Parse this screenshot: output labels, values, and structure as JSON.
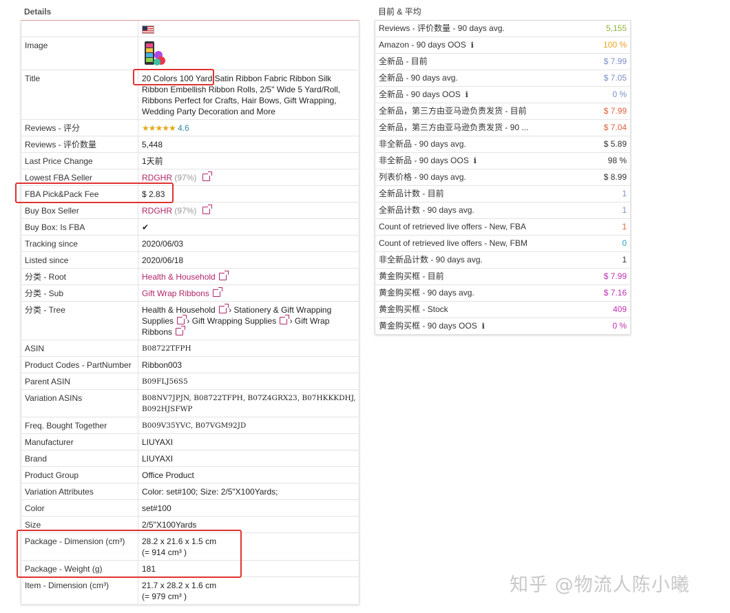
{
  "details": {
    "title": "Details",
    "image_label": "Image",
    "title_label": "Title",
    "title_value": "20 Colors 100 Yard Satin Ribbon Fabric Ribbon Silk Ribbon Embellish Ribbon Rolls, 2/5\" Wide 5 Yard/Roll, Ribbons Perfect for Crafts, Hair Bows, Gift Wrapping, Wedding Party Decoration and More",
    "reviews_rating_label": "Reviews - 评分",
    "reviews_rating_value": "4.6",
    "reviews_count_label": "Reviews - 评价数量",
    "reviews_count_value": "5,448",
    "last_price_change_label": "Last Price Change",
    "last_price_change_value": "1天前",
    "lowest_fba_seller_label": "Lowest FBA Seller",
    "lowest_fba_seller_value": "RDGHR",
    "lowest_fba_seller_pct": "(97%)",
    "fba_fee_label": "FBA Pick&Pack Fee",
    "fba_fee_value": "$ 2.83",
    "buybox_seller_label": "Buy Box Seller",
    "buybox_seller_value": "RDGHR",
    "buybox_seller_pct": "(97%)",
    "buybox_fba_label": "Buy Box: Is FBA",
    "buybox_fba_value": "✔",
    "tracking_since_label": "Tracking since",
    "tracking_since_value": "2020/06/03",
    "listed_since_label": "Listed since",
    "listed_since_value": "2020/06/18",
    "cat_root_label": "分类 - Root",
    "cat_root_value": "Health & Household",
    "cat_sub_label": "分类 - Sub",
    "cat_sub_value": "Gift Wrap Ribbons",
    "cat_tree_label": "分类 - Tree",
    "cat_tree_1": "Health & Household",
    "cat_tree_2": "Stationery & Gift Wrapping Supplies",
    "cat_tree_3": "Gift Wrapping Supplies",
    "cat_tree_4": "Gift Wrap Ribbons",
    "tree_sep": "›",
    "asin_label": "ASIN",
    "asin_value": "B08722TFPH",
    "partnumber_label": "Product Codes - PartNumber",
    "partnumber_value": "Ribbon003",
    "parent_asin_label": "Parent ASIN",
    "parent_asin_value": "B09FLJ56S5",
    "variation_asins_label": "Variation ASINs",
    "variation_asins_value": "B08NV7JPJN, B08722TFPH, B07Z4GRX23, B07HKKKDHJ, B092HJSFWP",
    "freq_bought_label": "Freq. Bought Together",
    "freq_bought_value": "B009V35YVC, B07VGM92JD",
    "manufacturer_label": "Manufacturer",
    "manufacturer_value": "LIUYAXI",
    "brand_label": "Brand",
    "brand_value": "LIUYAXI",
    "product_group_label": "Product Group",
    "product_group_value": "Office Product",
    "variation_attr_label": "Variation Attributes",
    "variation_attr_value": "Color: set#100; Size: 2/5\"X100Yards;",
    "color_label": "Color",
    "color_value": "set#100",
    "size_label": "Size",
    "size_value": "2/5\"X100Yards",
    "pkg_dim_label": "Package - Dimension (cm³)",
    "pkg_dim_value": "28.2 x 21.6 x 1.5 cm",
    "pkg_dim_volume": "(= 914 cm³ )",
    "pkg_weight_label": "Package - Weight (g)",
    "pkg_weight_value": "181",
    "item_dim_label": "Item - Dimension (cm³)",
    "item_dim_value": "21.7 x 28.2 x 1.6 cm",
    "item_dim_volume": "(= 979 cm³ )"
  },
  "current": {
    "title": "目前 & 平均",
    "rows": [
      {
        "label": "Reviews - 评价数量 - 90 days avg.",
        "value": "5,155",
        "color": "#8db23a",
        "info": false
      },
      {
        "label": "Amazon - 90 days OOS",
        "value": "100 %",
        "color": "#f0a020",
        "info": true
      },
      {
        "label": "全新品 - 目前",
        "value": "$ 7.99",
        "color": "#7a8ec8",
        "info": false
      },
      {
        "label": "全新品 - 90 days avg.",
        "value": "$ 7.05",
        "color": "#7a8ec8",
        "info": false
      },
      {
        "label": "全新品 - 90 days OOS",
        "value": "0 %",
        "color": "#7a8ec8",
        "info": true
      },
      {
        "label": "全新品，第三方由亚马逊负责发货 - 目前",
        "value": "$ 7.99",
        "color": "#e0603a",
        "info": false
      },
      {
        "label": "全新品，第三方由亚马逊负责发货 - 90 ...",
        "value": "$ 7.04",
        "color": "#e0603a",
        "info": false
      },
      {
        "label": "非全新品 - 90 days avg.",
        "value": "$ 5.89",
        "color": "#333333",
        "info": false
      },
      {
        "label": "非全新品 - 90 days OOS",
        "value": "98 %",
        "color": "#333333",
        "info": true
      },
      {
        "label": "列表价格 - 90 days avg.",
        "value": "$ 8.99",
        "color": "#333333",
        "info": false
      },
      {
        "label": "全新品计数 - 目前",
        "value": "1",
        "color": "#7a8ec8",
        "info": false
      },
      {
        "label": "全新品计数 - 90 days avg.",
        "value": "1",
        "color": "#7a8ec8",
        "info": false
      },
      {
        "label": "Count of retrieved live offers - New, FBA",
        "value": "1",
        "color": "#e0603a",
        "info": false
      },
      {
        "label": "Count of retrieved live offers - New, FBM",
        "value": "0",
        "color": "#2aa0c8",
        "info": false
      },
      {
        "label": "非全新品计数 - 90 days avg.",
        "value": "1",
        "color": "#333333",
        "info": false
      },
      {
        "label": "黄金购买框 - 目前",
        "value": "$ 7.99",
        "color": "#c030b0",
        "info": false
      },
      {
        "label": "黄金购买框 - 90 days avg.",
        "value": "$ 7.16",
        "color": "#c030b0",
        "info": false
      },
      {
        "label": "黄金购买框 - Stock",
        "value": "409",
        "color": "#c030b0",
        "info": false
      },
      {
        "label": "黄金购买框 - 90 days OOS",
        "value": "0 %",
        "color": "#c030b0",
        "info": true
      }
    ]
  },
  "watermark": "知乎 @物流人陈小曦",
  "icons": {
    "flag": "us-flag-icon",
    "info": "info-icon",
    "external": "external-link-icon",
    "check": "checkmark-icon",
    "stars": "star-rating-icon"
  }
}
